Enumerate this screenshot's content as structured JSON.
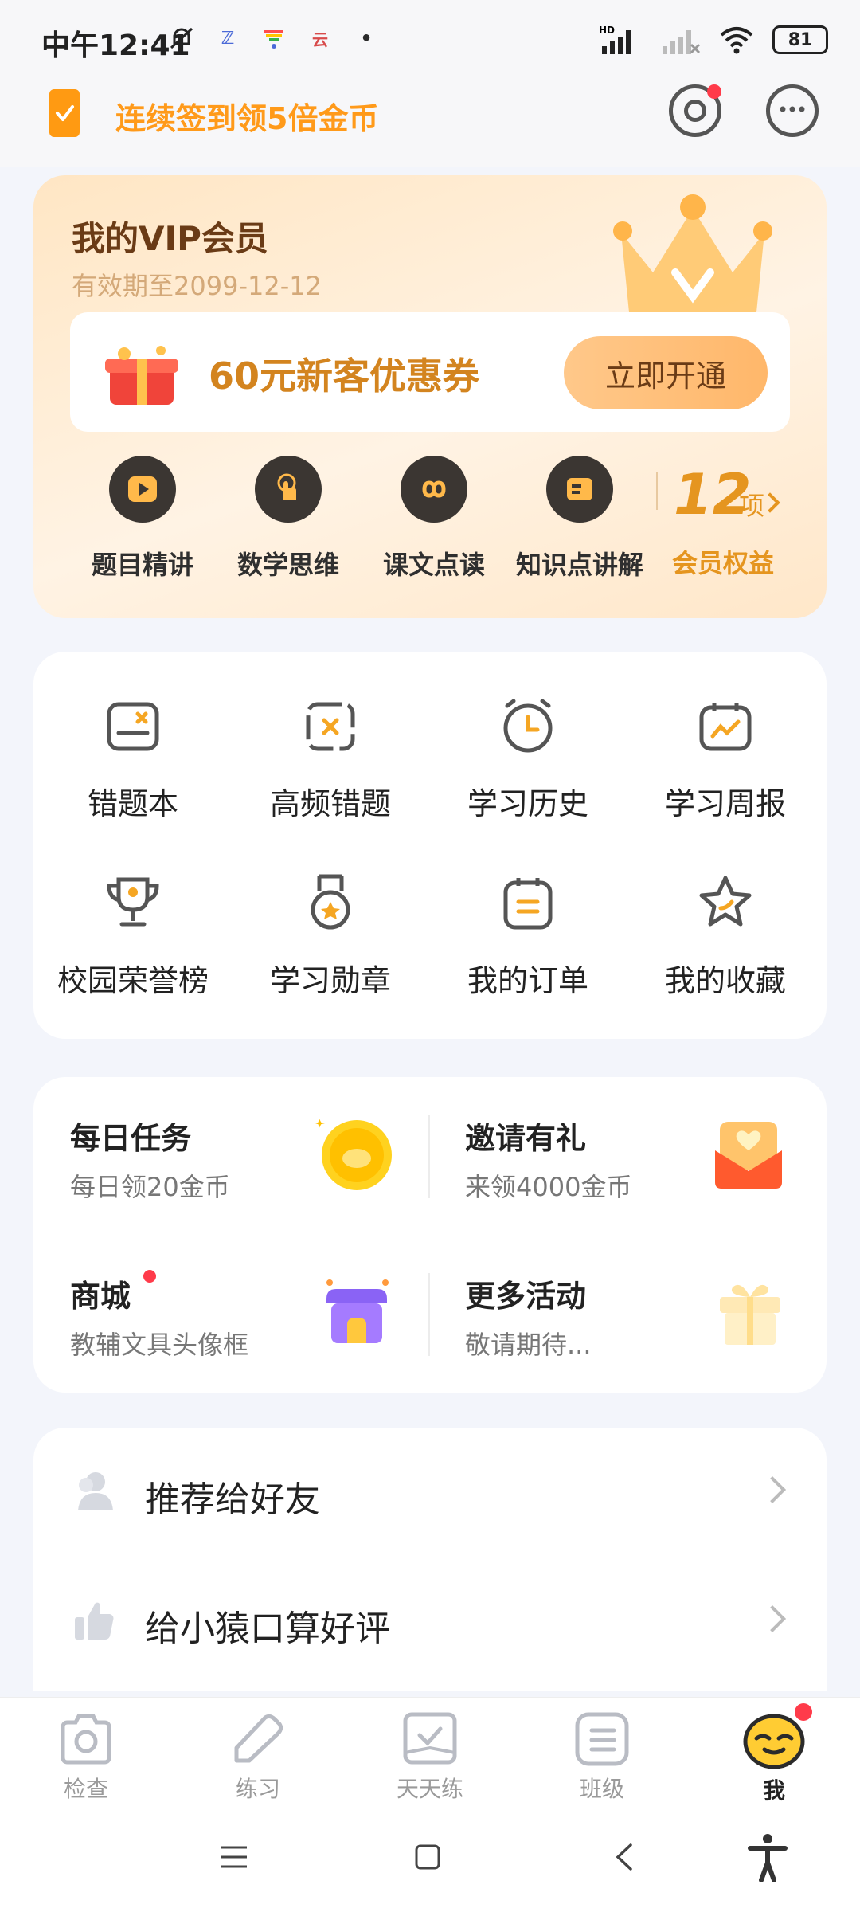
{
  "status_bar": {
    "time": "中午12:41",
    "battery": "81"
  },
  "top_bar": {
    "task_text": "连续签到领5倍金币"
  },
  "vip": {
    "title": "我的VIP会员",
    "expiry": "有效期至2099-12-12",
    "coupon_text": "60元新客优惠券",
    "open_button": "立即开通",
    "features": [
      {
        "label": "题目精讲",
        "icon": "play-icon"
      },
      {
        "label": "数学思维",
        "icon": "tap-hand-icon"
      },
      {
        "label": "课文点读",
        "icon": "infinity-icon"
      },
      {
        "label": "知识点讲解",
        "icon": "card-icon"
      }
    ],
    "rights_count": "12",
    "rights_unit": "项",
    "rights_label": "会员权益"
  },
  "tools": [
    {
      "label": "错题本",
      "icon": "wrong-book-icon"
    },
    {
      "label": "高频错题",
      "icon": "frequent-errors-icon"
    },
    {
      "label": "学习历史",
      "icon": "clock-icon"
    },
    {
      "label": "学习周报",
      "icon": "calendar-chart-icon"
    },
    {
      "label": "校园荣誉榜",
      "icon": "trophy-icon"
    },
    {
      "label": "学习勋章",
      "icon": "medal-icon"
    },
    {
      "label": "我的订单",
      "icon": "order-icon"
    },
    {
      "label": "我的收藏",
      "icon": "star-icon"
    }
  ],
  "activities": [
    {
      "title": "每日任务",
      "subtitle": "每日领20金币",
      "icon": "coin-icon"
    },
    {
      "title": "邀请有礼",
      "subtitle": "来领4000金币",
      "icon": "envelope-heart-icon"
    },
    {
      "title": "商城",
      "subtitle": "教辅文具头像框",
      "icon": "shop-icon"
    },
    {
      "title": "更多活动",
      "subtitle": "敬请期待...",
      "icon": "gift-icon"
    }
  ],
  "list": [
    {
      "label": "推荐给好友",
      "icon": "friends-icon"
    },
    {
      "label": "给小猿口算好评",
      "icon": "thumbs-up-icon"
    }
  ],
  "bottom_nav": [
    {
      "label": "检查",
      "icon": "camera-icon"
    },
    {
      "label": "练习",
      "icon": "pencil-tag-icon"
    },
    {
      "label": "天天练",
      "icon": "daily-check-icon"
    },
    {
      "label": "班级",
      "icon": "list-icon"
    },
    {
      "label": "我",
      "icon": "avatar-icon"
    }
  ],
  "colors": {
    "accent_orange": "#ff9a1a",
    "vip_brown": "#6a3b16",
    "gold": "#e5951f",
    "badge_red": "#ff3b4a"
  }
}
